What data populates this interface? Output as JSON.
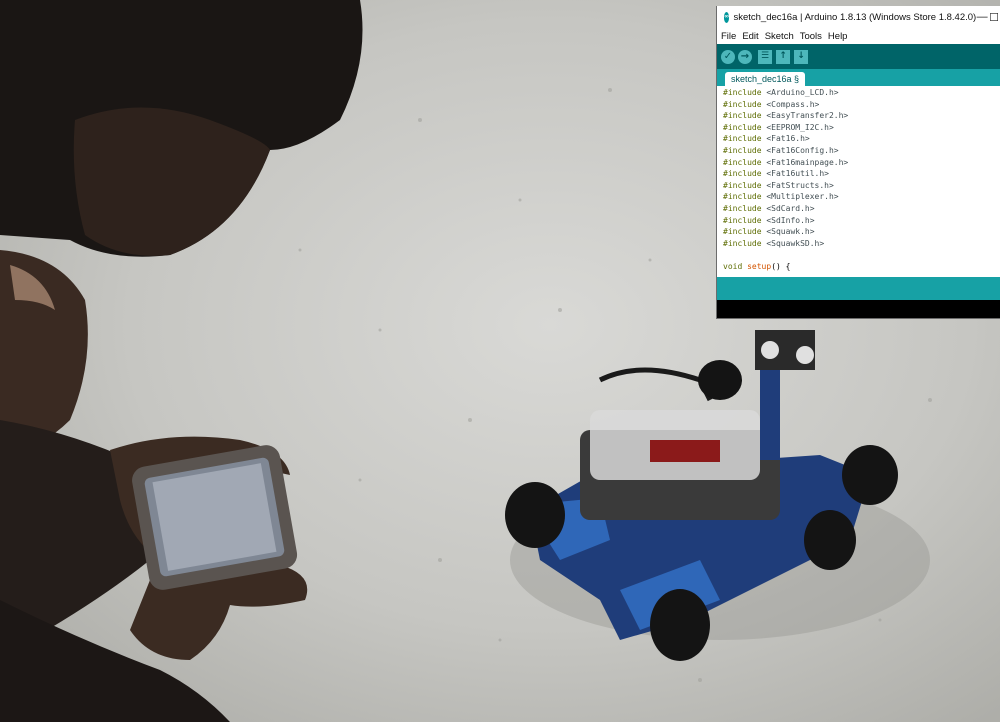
{
  "window": {
    "title": "sketch_dec16a | Arduino 1.8.13 (Windows Store 1.8.42.0)",
    "minimize": "—",
    "maximize": "☐"
  },
  "menu": [
    "File",
    "Edit",
    "Sketch",
    "Tools",
    "Help"
  ],
  "toolbar": {
    "verify_icon": "✓",
    "upload_icon": "→",
    "new_icon": "☰",
    "open_icon": "↑",
    "save_icon": "↓"
  },
  "tab": {
    "label": "sketch_dec16a §"
  },
  "code": {
    "includes": [
      "<Arduino_LCD.h>",
      "<Compass.h>",
      "<EasyTransfer2.h>",
      "<EEPROM_I2C.h>",
      "<Fat16.h>",
      "<Fat16Config.h>",
      "<Fat16mainpage.h>",
      "<Fat16util.h>",
      "<FatStructs.h>",
      "<Multiplexer.h>",
      "<SdCard.h>",
      "<SdInfo.h>",
      "<Squawk.h>",
      "<SquawkSD.h>"
    ],
    "include_keyword": "#include",
    "setup_kw": "void",
    "setup_fn": "setup",
    "setup_rest": "() {"
  },
  "colors": {
    "arduino_teal": "#00979c",
    "toolbar_dark": "#006468",
    "tab_bar": "#17a1a5"
  }
}
